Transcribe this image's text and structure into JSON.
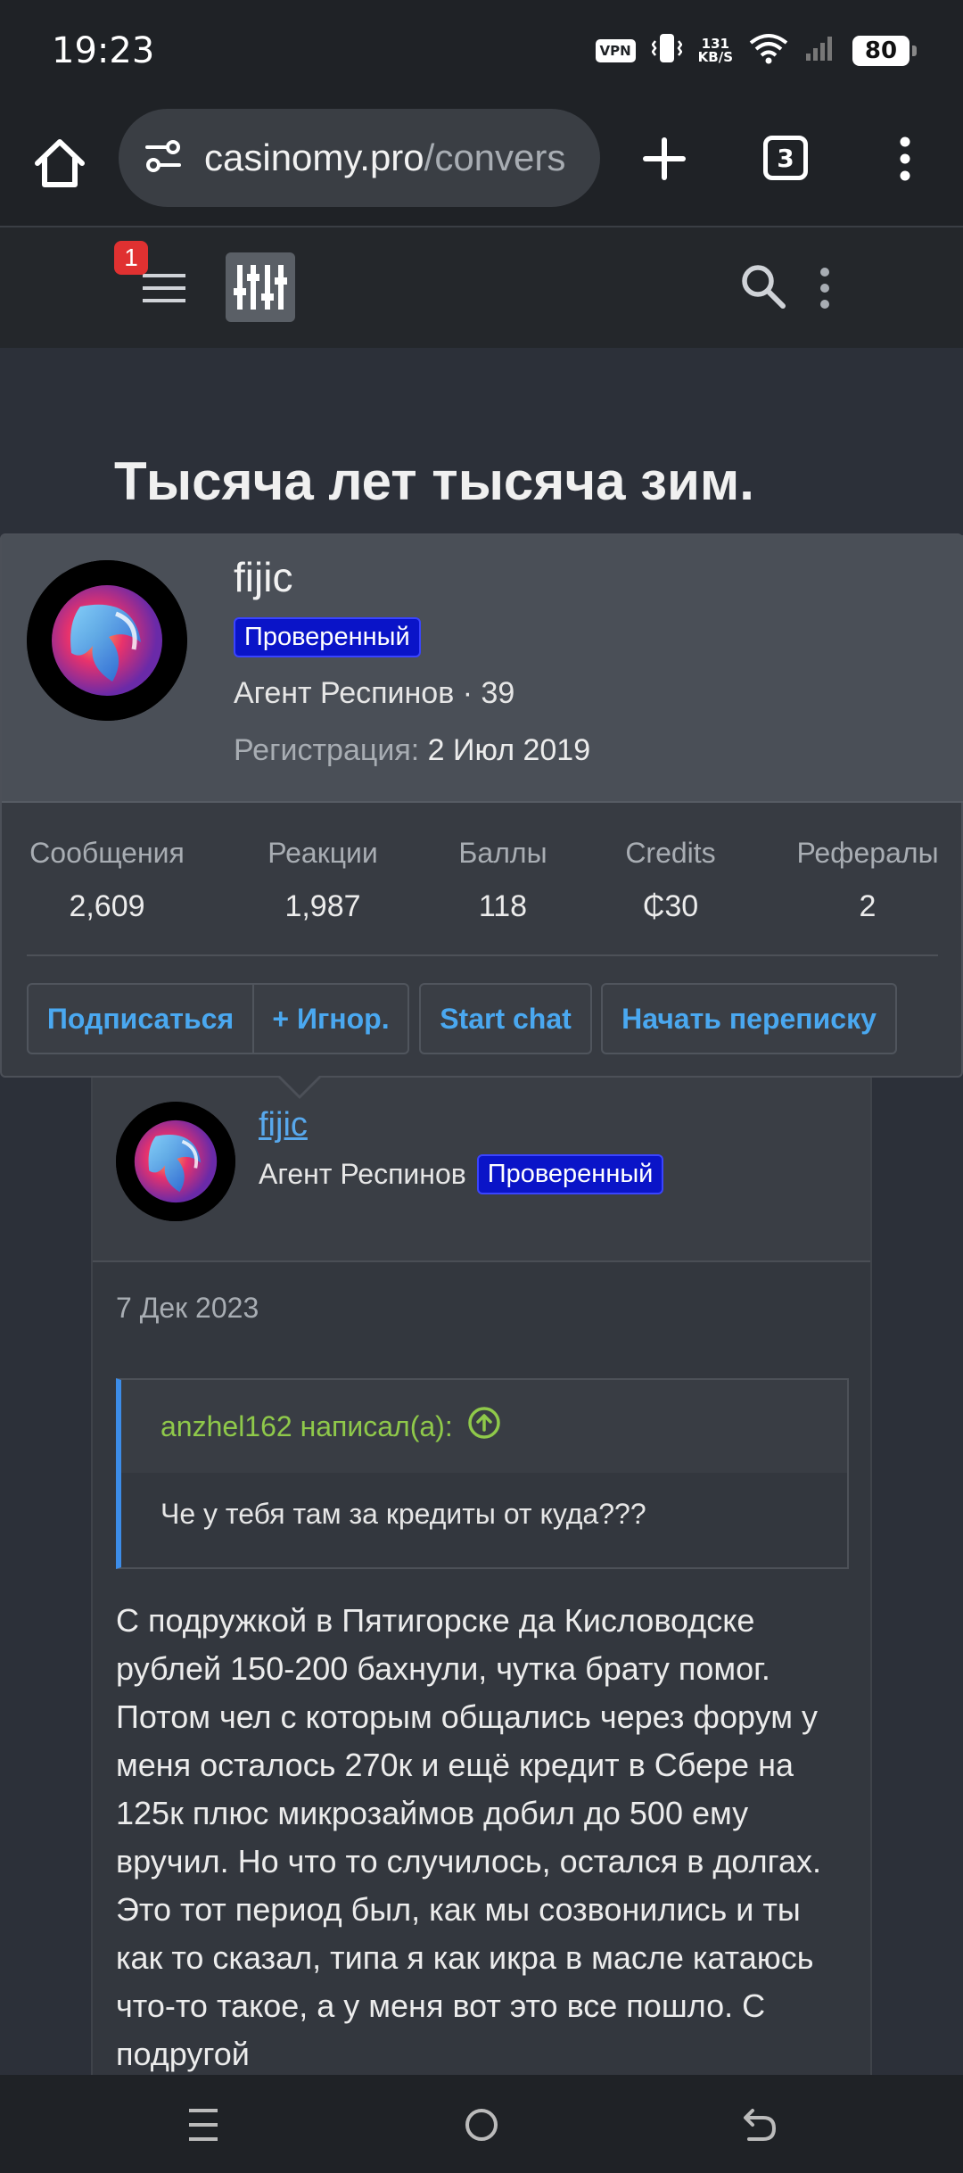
{
  "status_bar": {
    "time": "19:23",
    "vpn": "VPN",
    "net_speed_value": "131",
    "net_speed_unit": "KB/S",
    "battery": "80"
  },
  "browser": {
    "url_host": "casinomy.pro",
    "url_path": "/convers",
    "tab_count": "3"
  },
  "site_header": {
    "notification_count": "1"
  },
  "page": {
    "title": "Тысяча лет тысяча зим."
  },
  "profile_popup": {
    "username": "fijic",
    "badge": "Проверенный",
    "user_title": "Агент Респинов · 39",
    "registration_label": "Регистрация:",
    "registration_date": "2 Июл 2019",
    "stats": [
      {
        "label": "Сообщения",
        "value": "2,609"
      },
      {
        "label": "Реакции",
        "value": "1,987"
      },
      {
        "label": "Баллы",
        "value": "118"
      },
      {
        "label": "Credits",
        "value": "₵30"
      },
      {
        "label": "Рефералы",
        "value": "2"
      }
    ],
    "actions": {
      "follow": "Подписаться",
      "ignore": "+ Игнор.",
      "start_chat": "Start chat",
      "start_conversation": "Начать переписку"
    }
  },
  "post": {
    "username": "fijic",
    "user_title": "Агент Респинов",
    "badge": "Проверенный",
    "date": "7 Дек 2023",
    "quote": {
      "author": "anzhel162 написал(а):",
      "text": "Че у тебя там за кредиты от куда???"
    },
    "body": "С подружкой в Пятигорске да Кисловодске рублей 150-200 бахнули, чутка брату помог. Потом чел с которым общались через форум у меня осталось 270к и ещё кредит в Сбере на 125к плюс микрозаймов добил до 500 ему вручил. Но что то случилось, остался в долгах. Это тот период был, как мы созвонились и ты как то сказал, типа я как икра в масле катаюсь что-то такое, а у меня вот это все пошло. С подругой"
  },
  "colors": {
    "page_bg": "#2c3039",
    "verified_badge": "#0a14c8",
    "link": "#58a8ec",
    "button_text": "#4aa8f0",
    "quote_author": "#8fc94a",
    "quote_border": "#3c8ce8",
    "notification_badge": "#e03131"
  },
  "icons": {
    "home": "home-icon",
    "site_settings": "tune-icon",
    "new_tab": "plus-icon",
    "tabs": "tab-switcher-icon",
    "overflow": "more-vertical-icon",
    "menu": "hamburger-icon",
    "search": "search-icon",
    "quote_jump": "arrow-up-circle-icon",
    "nav_recent": "recent-apps-icon",
    "nav_home": "home-circle-icon",
    "nav_back": "back-icon"
  }
}
